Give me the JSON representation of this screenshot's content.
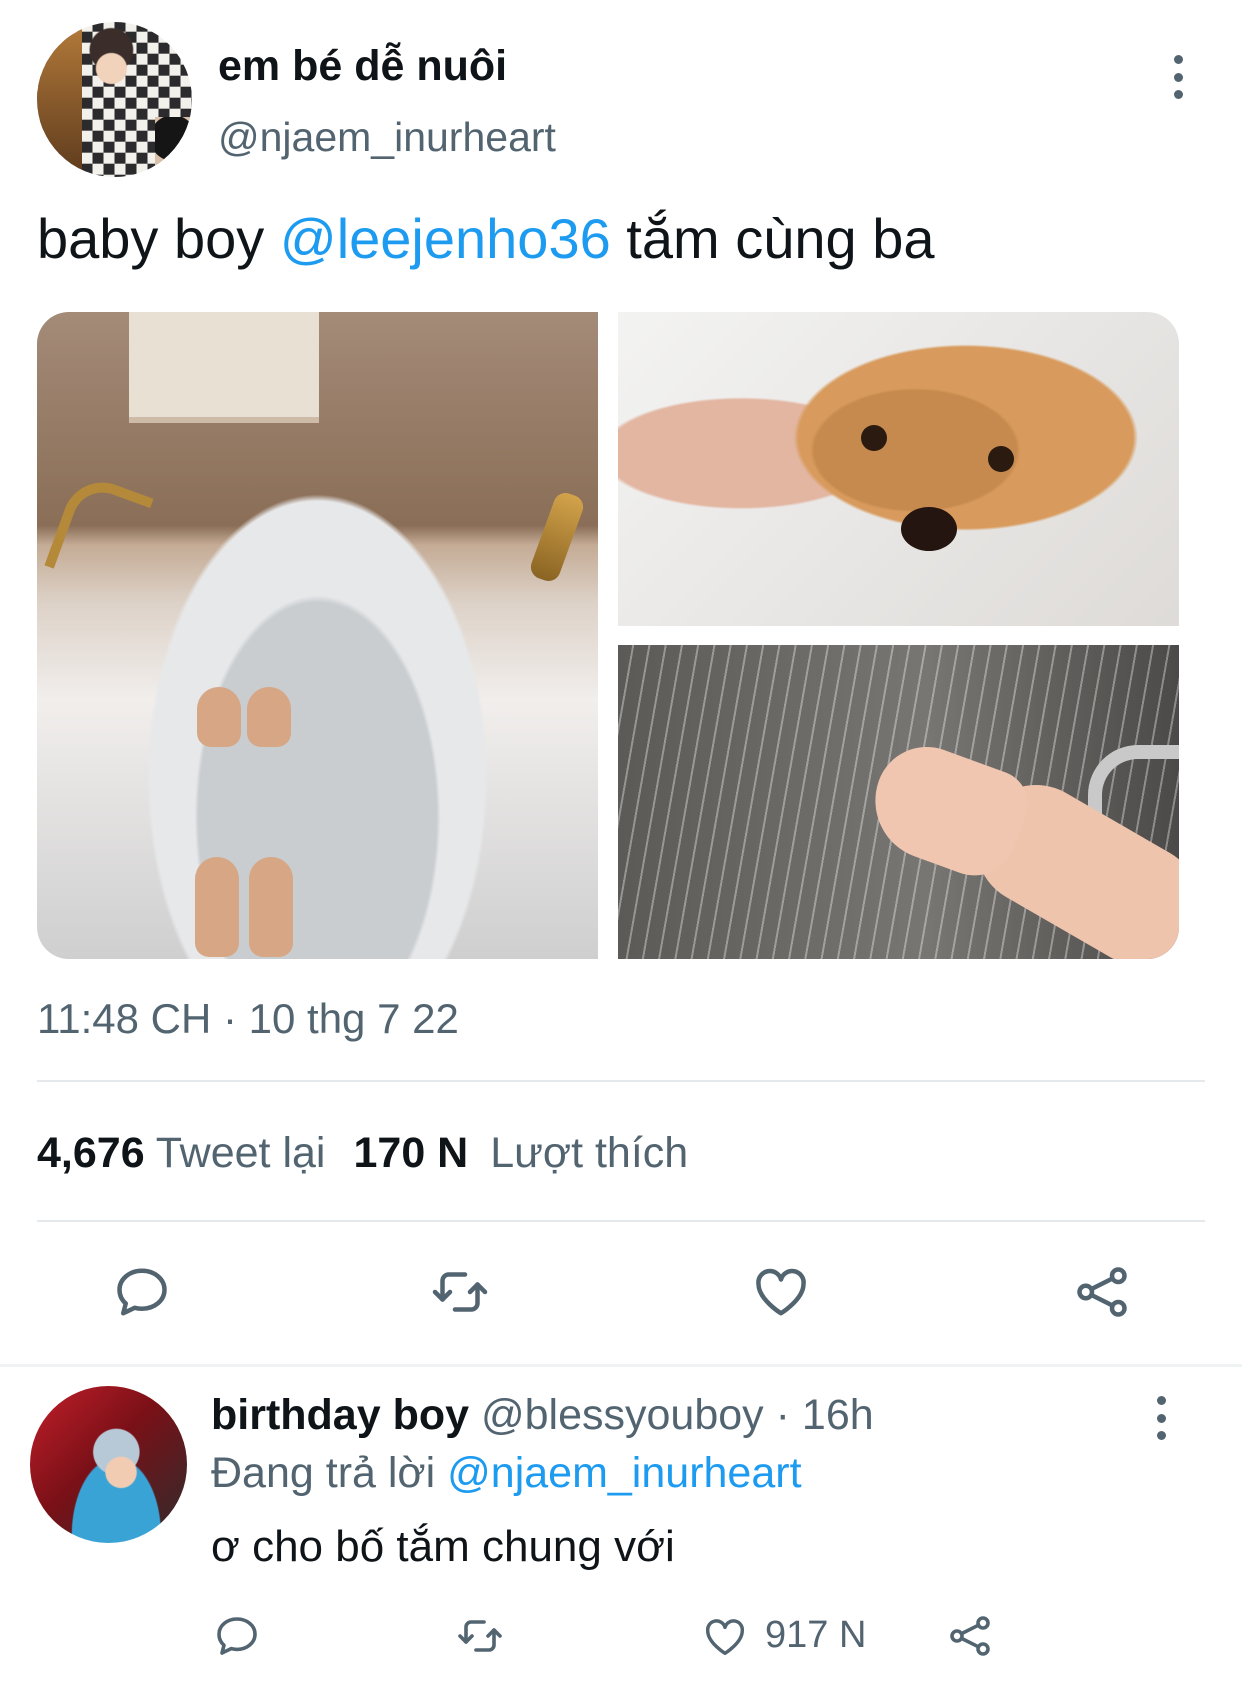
{
  "tweet": {
    "display_name": "em bé dễ nuôi",
    "handle": "@njaem_inurheart",
    "text_before": "baby boy ",
    "mention": "@leejenho36",
    "text_after": " tắm cùng ba",
    "timestamp": "11:48 CH · 10 thg 7 22",
    "stats": {
      "retweet_count": "4,676",
      "retweet_label": "Tweet lại",
      "like_count": "170 N",
      "like_label": "Lượt thích"
    },
    "icons": {
      "more": "more-vertical-icon",
      "reply": "reply-icon",
      "retweet": "retweet-icon",
      "like": "heart-icon",
      "share": "share-icon"
    }
  },
  "reply": {
    "display_name": "birthday boy",
    "handle": "@blessyouboy",
    "time": "16h",
    "replying_prefix": "Đang trả lời ",
    "replying_to": "@njaem_inurheart",
    "text": "ơ cho bố tắm chung với",
    "like_count": "917 N"
  },
  "colors": {
    "accent": "#1d9bf0",
    "secondary_text": "#536471",
    "primary_text": "#0f1419"
  }
}
